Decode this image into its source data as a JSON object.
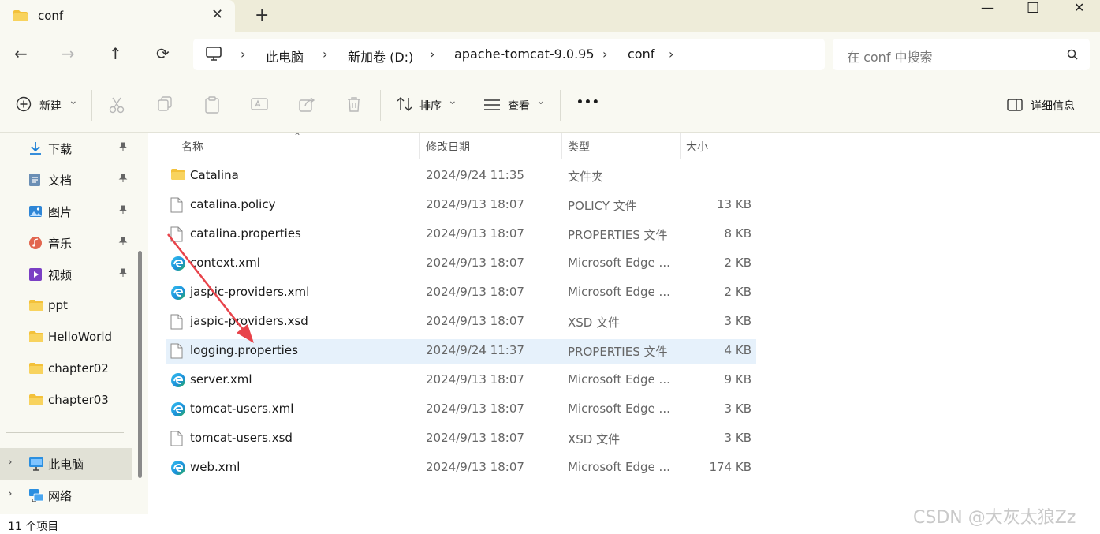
{
  "tab": {
    "title": "conf",
    "close_glyph": "✕",
    "new_tab_glyph": "+"
  },
  "window": {
    "minimize": "—",
    "maximize": "☐",
    "close": "✕"
  },
  "nav": {
    "back": "←",
    "forward": "→",
    "up": "↑",
    "refresh": "⟳"
  },
  "breadcrumb": {
    "items": [
      "此电脑",
      "新加卷 (D:)",
      "apache-tomcat-9.0.95",
      "conf"
    ],
    "separator": "›"
  },
  "search": {
    "placeholder": "在 conf 中搜索"
  },
  "toolbar": {
    "new_label": "新建",
    "sort_label": "排序",
    "view_label": "查看",
    "more_label": "•••",
    "details_label": "详细信息",
    "dropdown_glyph": "⌄"
  },
  "sidebar": {
    "pinned": [
      {
        "label": "下载",
        "icon": "download-icon"
      },
      {
        "label": "文档",
        "icon": "document-icon"
      },
      {
        "label": "图片",
        "icon": "pictures-icon"
      },
      {
        "label": "音乐",
        "icon": "music-icon"
      },
      {
        "label": "视频",
        "icon": "video-icon"
      }
    ],
    "folders": [
      "ppt",
      "HelloWorld",
      "chapter02",
      "chapter03"
    ],
    "this_pc": "此电脑",
    "network": "网络",
    "pin_glyph": "📌",
    "expand_glyph": "›"
  },
  "columns": {
    "name": "名称",
    "modified": "修改日期",
    "type": "类型",
    "size": "大小"
  },
  "files": [
    {
      "name": "Catalina",
      "modified": "2024/9/24 11:35",
      "type": "文件夹",
      "size": "",
      "icon": "folder"
    },
    {
      "name": "catalina.policy",
      "modified": "2024/9/13 18:07",
      "type": "POLICY 文件",
      "size": "13 KB",
      "icon": "file"
    },
    {
      "name": "catalina.properties",
      "modified": "2024/9/13 18:07",
      "type": "PROPERTIES 文件",
      "size": "8 KB",
      "icon": "file"
    },
    {
      "name": "context.xml",
      "modified": "2024/9/13 18:07",
      "type": "Microsoft Edge ...",
      "size": "2 KB",
      "icon": "edge"
    },
    {
      "name": "jaspic-providers.xml",
      "modified": "2024/9/13 18:07",
      "type": "Microsoft Edge ...",
      "size": "2 KB",
      "icon": "edge"
    },
    {
      "name": "jaspic-providers.xsd",
      "modified": "2024/9/13 18:07",
      "type": "XSD 文件",
      "size": "3 KB",
      "icon": "file"
    },
    {
      "name": "logging.properties",
      "modified": "2024/9/24 11:37",
      "type": "PROPERTIES 文件",
      "size": "4 KB",
      "icon": "file",
      "selected": true
    },
    {
      "name": "server.xml",
      "modified": "2024/9/13 18:07",
      "type": "Microsoft Edge ...",
      "size": "9 KB",
      "icon": "edge"
    },
    {
      "name": "tomcat-users.xml",
      "modified": "2024/9/13 18:07",
      "type": "Microsoft Edge ...",
      "size": "3 KB",
      "icon": "edge"
    },
    {
      "name": "tomcat-users.xsd",
      "modified": "2024/9/13 18:07",
      "type": "XSD 文件",
      "size": "3 KB",
      "icon": "file"
    },
    {
      "name": "web.xml",
      "modified": "2024/9/13 18:07",
      "type": "Microsoft Edge ...",
      "size": "174 KB",
      "icon": "edge"
    }
  ],
  "status": {
    "count": "11 个项目"
  },
  "watermark": "CSDN @大灰太狼Zz",
  "colors": {
    "accent": "#0067c0",
    "selected_row": "#e6f1fb",
    "folder": "#f3c13a",
    "annotation_arrow": "#e8434a"
  }
}
